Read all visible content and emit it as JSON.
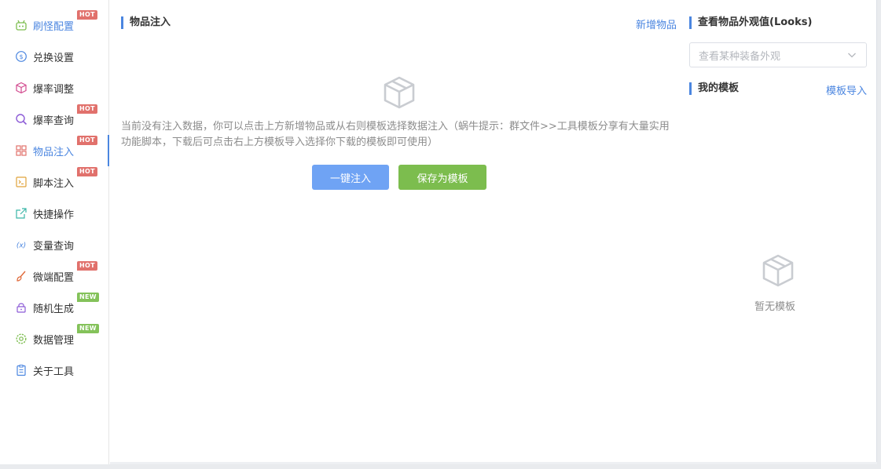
{
  "sidebar": {
    "items": [
      {
        "label": "刷怪配置",
        "badge": "HOT"
      },
      {
        "label": "兑换设置",
        "badge": ""
      },
      {
        "label": "爆率调整",
        "badge": ""
      },
      {
        "label": "爆率查询",
        "badge": "HOT"
      },
      {
        "label": "物品注入",
        "badge": "HOT"
      },
      {
        "label": "脚本注入",
        "badge": "HOT"
      },
      {
        "label": "快捷操作",
        "badge": ""
      },
      {
        "label": "变量查询",
        "badge": ""
      },
      {
        "label": "微端配置",
        "badge": "HOT"
      },
      {
        "label": "随机生成",
        "badge": "NEW"
      },
      {
        "label": "数据管理",
        "badge": "NEW"
      },
      {
        "label": "关于工具",
        "badge": ""
      }
    ],
    "active_index": 4
  },
  "main": {
    "title": "物品注入",
    "add_link": "新增物品",
    "empty_text": "当前没有注入数据，你可以点击上方新增物品或从右则模板选择数据注入（蜗牛提示：群文件>>工具模板分享有大量实用功能脚本，下载后可点击右上方模板导入选择你下载的模板即可使用）",
    "inject_button": "一键注入",
    "save_template_button": "保存为模板"
  },
  "right": {
    "looks_title": "查看物品外观值(Looks)",
    "looks_placeholder": "查看某种装备外观",
    "templates_title": "我的模板",
    "import_link": "模板导入",
    "empty_templates": "暂无模板"
  },
  "colors": {
    "accent": "#4b86e0",
    "primary_button": "#6fa3f4",
    "success_button": "#7cbd4e",
    "hot_badge": "#e1716c",
    "new_badge": "#84c25a"
  }
}
